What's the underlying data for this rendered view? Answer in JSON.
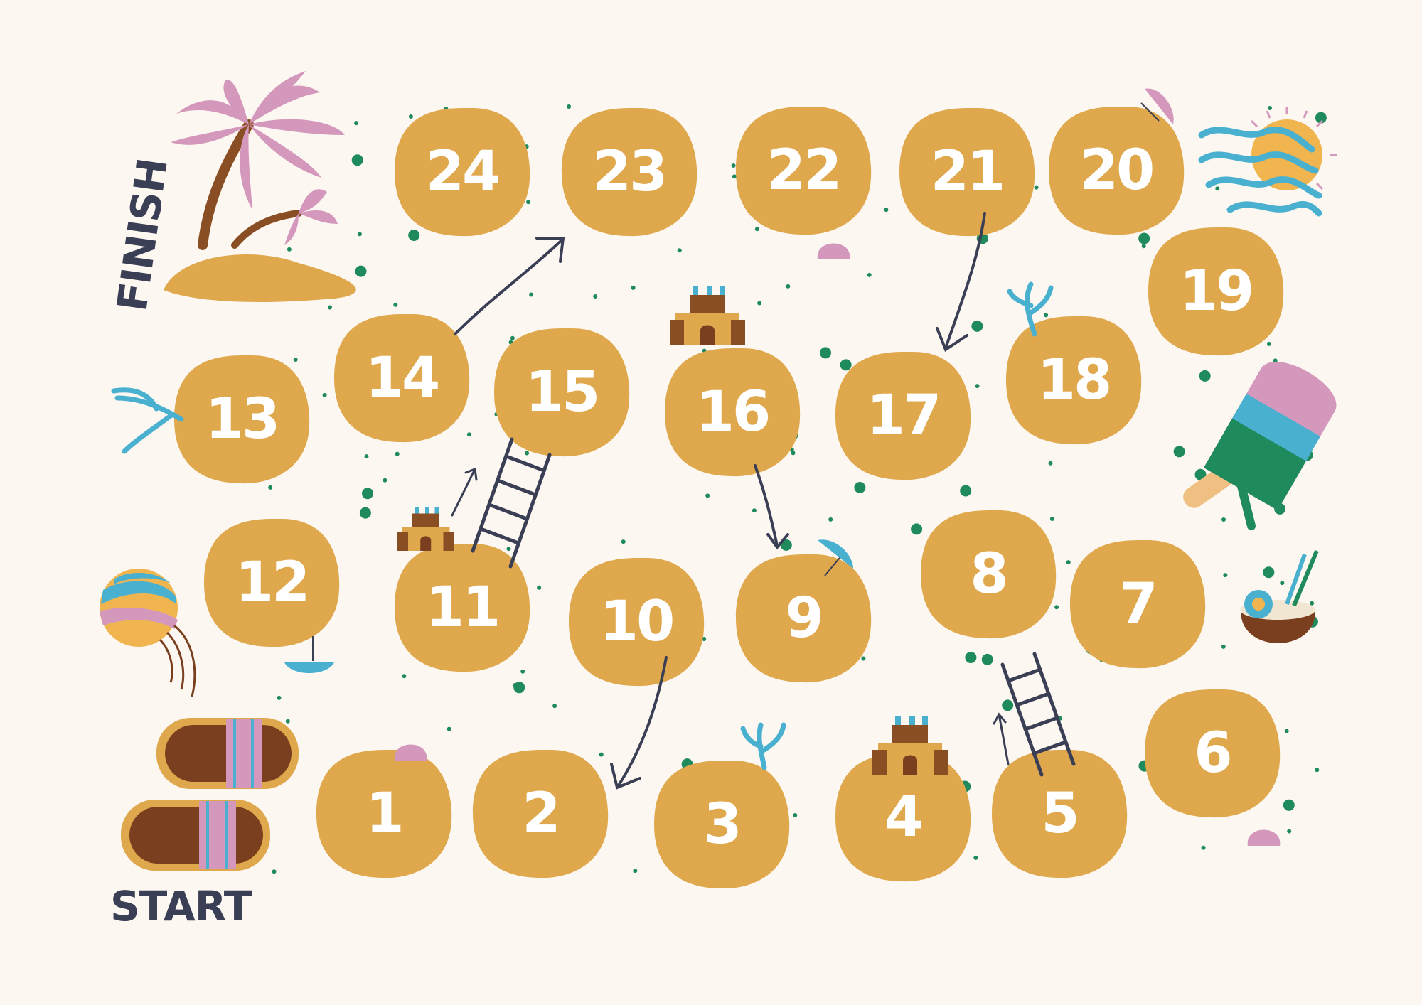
{
  "board": {
    "start_label": "START",
    "finish_label": "FINISH",
    "tiles": [
      {
        "number": "1"
      },
      {
        "number": "2"
      },
      {
        "number": "3"
      },
      {
        "number": "4"
      },
      {
        "number": "5"
      },
      {
        "number": "6"
      },
      {
        "number": "7"
      },
      {
        "number": "8"
      },
      {
        "number": "9"
      },
      {
        "number": "10"
      },
      {
        "number": "11"
      },
      {
        "number": "12"
      },
      {
        "number": "13"
      },
      {
        "number": "14"
      },
      {
        "number": "15"
      },
      {
        "number": "16"
      },
      {
        "number": "17"
      },
      {
        "number": "18"
      },
      {
        "number": "19"
      },
      {
        "number": "20"
      },
      {
        "number": "21"
      },
      {
        "number": "22"
      },
      {
        "number": "23"
      },
      {
        "number": "24"
      }
    ],
    "ladders": [
      {
        "from": "5",
        "to": "8"
      },
      {
        "from": "11",
        "to": "15"
      }
    ],
    "slides": [
      {
        "from": "21",
        "to": "17"
      },
      {
        "from": "16",
        "to": "9"
      },
      {
        "from": "10",
        "to": "2"
      },
      {
        "from": "14",
        "to": "23"
      }
    ]
  },
  "colors": {
    "background": "#fcf7f0",
    "tile": "#e0a84d",
    "tile_text": "#ffffff",
    "label_text": "#3b3f55",
    "dots": "#1f8a5b",
    "coral": "#4ab0d0",
    "palm_leaves": "#d598bd"
  },
  "icons": [
    "palm-tree-icon",
    "sun-waves-icon",
    "popsicle-icon",
    "coconut-drink-icon",
    "beach-ball-icon",
    "sandals-icon",
    "sandcastle-icon",
    "beach-umbrella-icon",
    "coral-icon",
    "seashell-icon"
  ]
}
